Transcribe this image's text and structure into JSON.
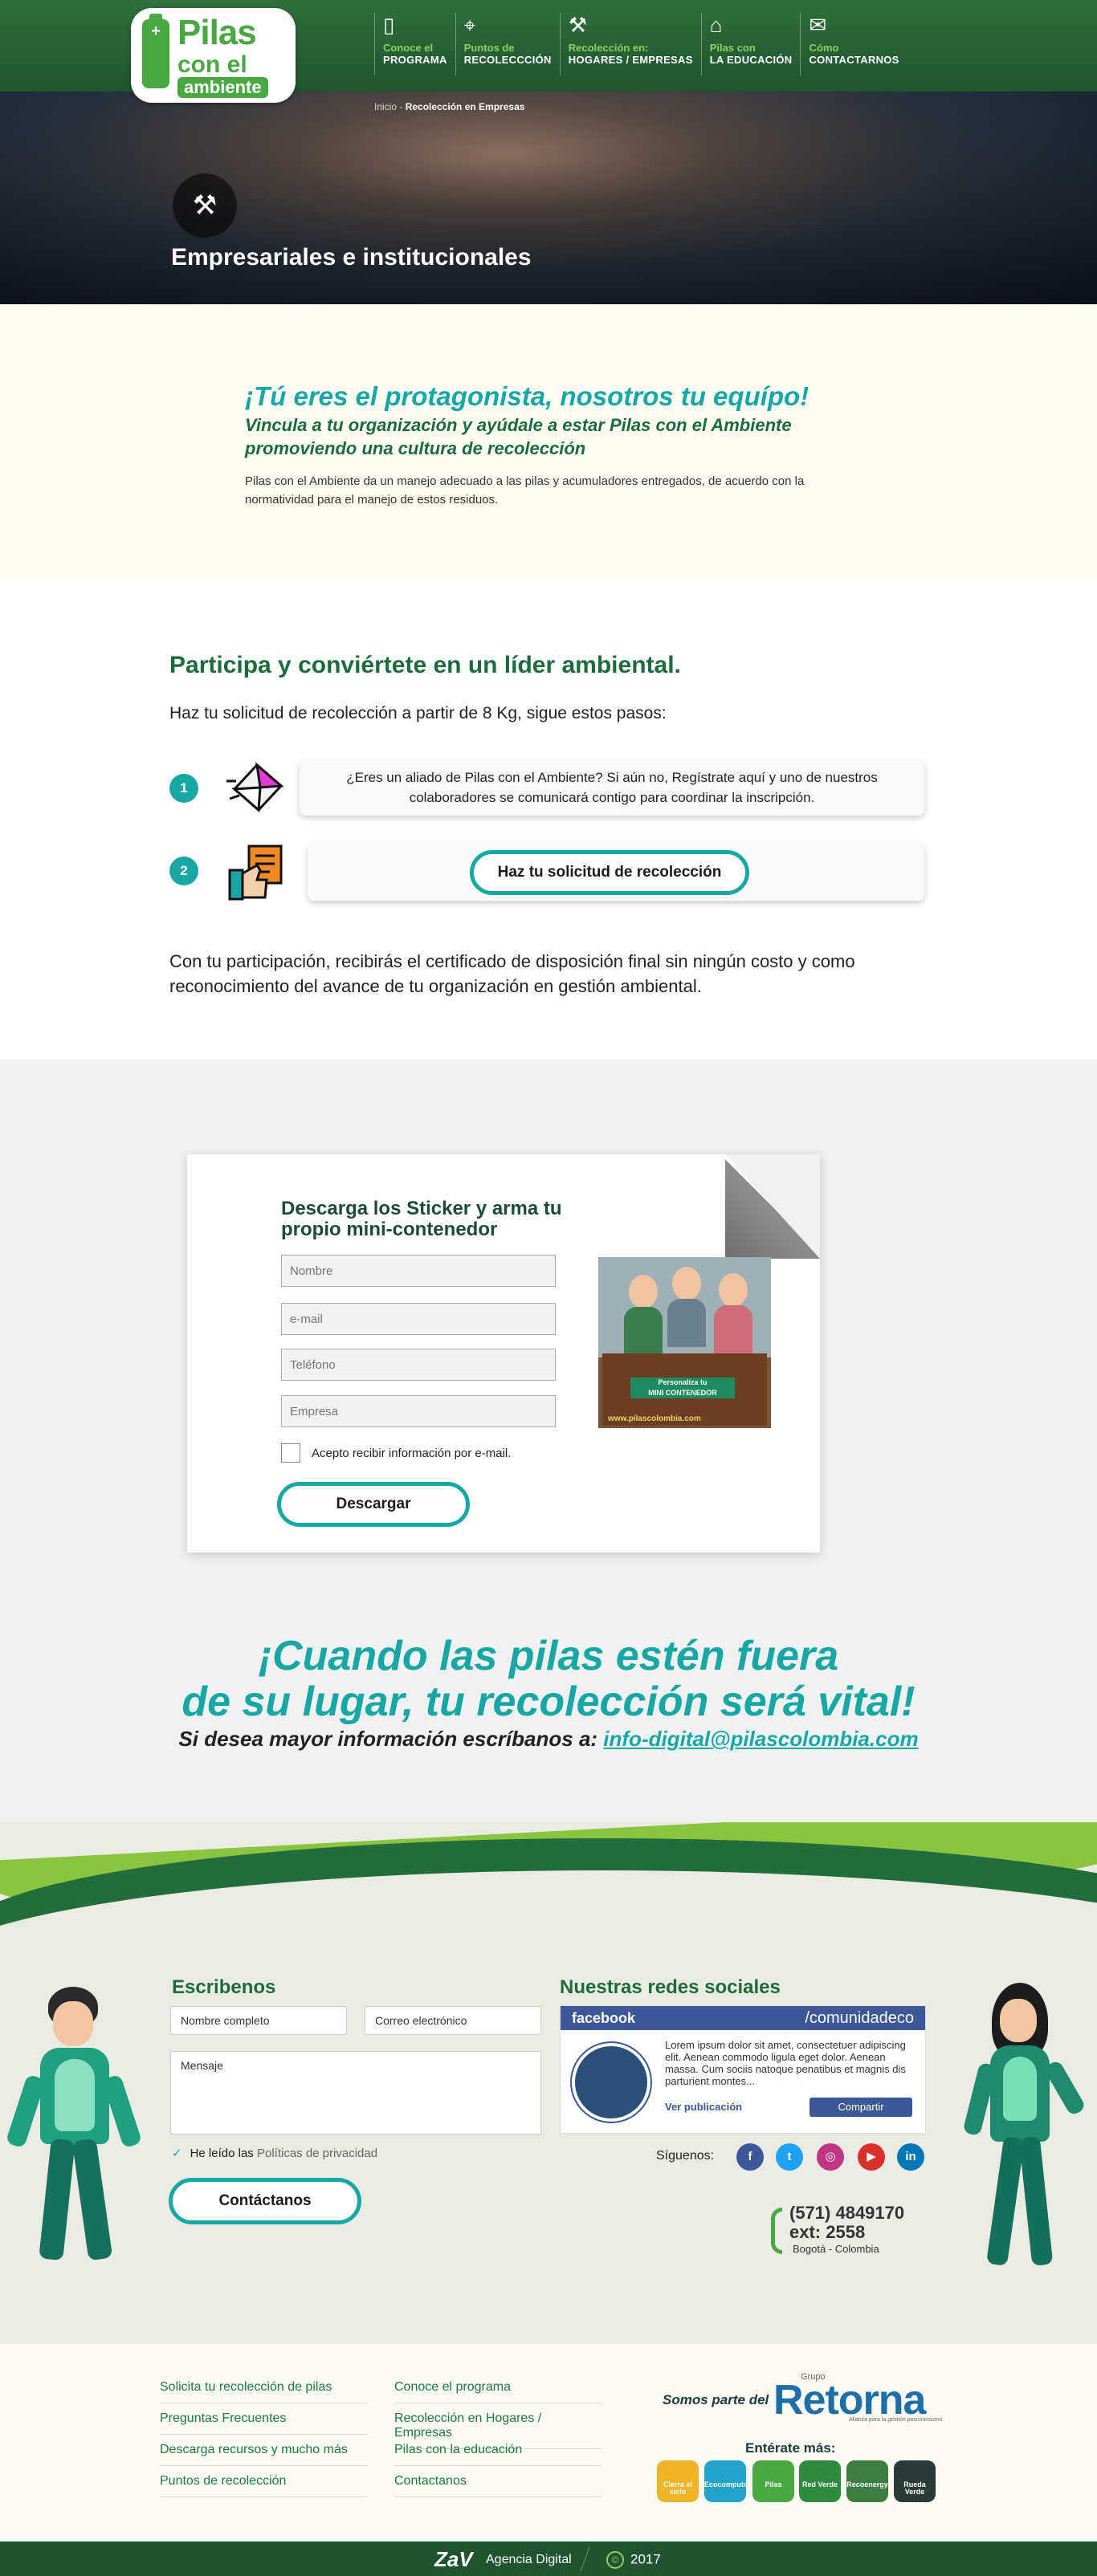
{
  "header": {
    "logo": {
      "line1": "Pilas",
      "line2": "con el",
      "line3": "ambiente"
    },
    "nav": [
      {
        "icon": "book-icon",
        "l1": "Conoce el",
        "l2": "PROGRAMA"
      },
      {
        "icon": "map-pin-icon",
        "l1": "Puntos de",
        "l2": "RECOLECCCIÓN"
      },
      {
        "icon": "worker-icon",
        "l1": "Recolección en:",
        "l2": "HOGARES / EMPRESAS"
      },
      {
        "icon": "graduation-cap-icon",
        "l1": "Pilas con",
        "l2": "LA EDUCACIÓN"
      },
      {
        "icon": "mail-icon",
        "l1": "Cómo",
        "l2": "CONTACTARNOS"
      }
    ]
  },
  "hero": {
    "breadcrumb_home": "Inicio",
    "breadcrumb_sep": " - ",
    "breadcrumb_current": "Recolección en Empresas",
    "title": "Empresariales e institucionales"
  },
  "intro": {
    "heading": "¡Tú eres el protagonista, nosotros tu equípo!",
    "subheading": "Vincula a tu organización y ayúdale a estar Pilas con el Ambiente promoviendo una cultura de recolección",
    "body": "Pilas con el Ambiente da un manejo adecuado a las pilas y acumuladores entregados, de acuerdo con la normatividad para el manejo de estos residuos."
  },
  "participa": {
    "heading": "Participa y conviértete en un líder ambiental.",
    "lead": "Haz tu solicitud de recolección a partir de 8 Kg, sigue estos pasos:",
    "steps": [
      {
        "num": "1",
        "text": "¿Eres un aliado de Pilas con el Ambiente? Si aún no, Regístrate aquí y uno de nuestros colaboradores se comunicará contigo para coordinar la inscripción."
      },
      {
        "num": "2",
        "button": "Haz tu solicitud de recolección"
      }
    ],
    "outro": "Con tu participación, recibirás el certificado de disposición  final sin ningún costo y como reconocimiento del avance de tu organización en gestión ambiental."
  },
  "sticker": {
    "title": "Descarga los Sticker y arma tu propio mini-contenedor",
    "fields": {
      "name": "Nombre",
      "email": "e-mail",
      "phone": "Teléfono",
      "company": "Empresa"
    },
    "consent": "Acepto recibir información por e-mail.",
    "button": "Descargar",
    "promo": {
      "line1": "Personaliza tu",
      "line2": "MINI CONTENEDOR",
      "url": "www.pilascolombia.com"
    }
  },
  "cta": {
    "line1": "¡Cuando las pilas estén fuera",
    "line2": "de su lugar, tu recolección será vital!",
    "prefix": "Si desea mayor información escríbanos a:",
    "email": "info-digital@pilascolombia.com"
  },
  "contact": {
    "heading": "Escribenos",
    "name_placeholder": "Nombre completo",
    "email_placeholder": "Correo electrónico",
    "message_placeholder": "Mensaje",
    "privacy_prefix": "He leído las",
    "privacy_link": "Políticas de privacidad",
    "button": "Contáctanos",
    "social_heading": "Nuestras redes sociales",
    "facebook": {
      "brand": "facebook",
      "handle": "/comunidadeco",
      "text": "Lorem ipsum dolor sit amet, consectetuer adipiscing elit. Aenean commodo ligula eget dolor. Aenean massa. Cum sociis natoque penatibus et magnis dis parturient montes...",
      "link": "Ver publicación",
      "share": "Compartir"
    },
    "follow": "Síguenos:",
    "socials": [
      {
        "icon": "facebook-icon",
        "glyph": "f",
        "color": "#3b5998"
      },
      {
        "icon": "twitter-icon",
        "glyph": "t",
        "color": "#1da1f2"
      },
      {
        "icon": "instagram-icon",
        "glyph": "◎",
        "color": "#c13584"
      },
      {
        "icon": "youtube-icon",
        "glyph": "▶",
        "color": "#d9302c"
      },
      {
        "icon": "linkedin-icon",
        "glyph": "in",
        "color": "#0077b5"
      }
    ],
    "phone": "(571) 4849170",
    "ext": "ext: 2558",
    "city": "Bogotá - Colombia"
  },
  "footer": {
    "col1": [
      "Solicita tu recolección de pilas",
      "Preguntas Frecuentes",
      "Descarga recursos y mucho más",
      "Puntos de recolección"
    ],
    "col2": [
      "Conoce el programa",
      "Recolección en Hogares / Empresas",
      "Pilas con la educación",
      "Contactanos"
    ],
    "somos": "Somos parte del",
    "retorna_group": "Grupo",
    "retorna": "Retorna",
    "retorna_sub": "Alianza para la gestión poscounsumo",
    "enterate": "Entérate más:",
    "brands": [
      {
        "label": "Cierra el ciclo",
        "color": "#f0b429"
      },
      {
        "label": "Ecocomputo",
        "color": "#23a3c9"
      },
      {
        "label": "Pilas",
        "color": "#49a842"
      },
      {
        "label": "Red Verde",
        "color": "#2e8b3e"
      },
      {
        "label": "Recoenergy",
        "color": "#3e7d42"
      },
      {
        "label": "Rueda Verde",
        "color": "#2a3a36"
      }
    ],
    "agency_logo": "ZaV",
    "agency": "Agencia Digital",
    "year": "2017"
  }
}
